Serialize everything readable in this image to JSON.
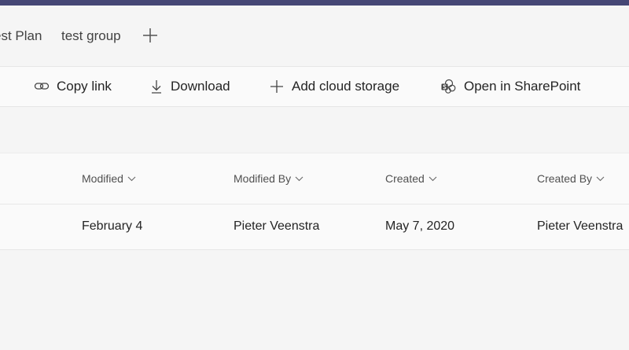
{
  "tabs": {
    "items": [
      {
        "label": "est Plan"
      },
      {
        "label": "test group"
      }
    ],
    "add_icon": "plus-icon"
  },
  "toolbar": {
    "copy_link": {
      "label": "Copy link",
      "icon": "link-icon"
    },
    "download": {
      "label": "Download",
      "icon": "download-icon"
    },
    "add_cloud_storage": {
      "label": "Add cloud storage",
      "icon": "plus-icon"
    },
    "open_in_sharepoint": {
      "label": "Open in SharePoint",
      "icon": "sharepoint-icon"
    }
  },
  "table": {
    "columns": [
      {
        "label": "Modified"
      },
      {
        "label": "Modified By"
      },
      {
        "label": "Created"
      },
      {
        "label": "Created By"
      }
    ],
    "rows": [
      {
        "modified": "February 4",
        "modified_by": "Pieter Veenstra",
        "created": "May 7, 2020",
        "created_by": "Pieter Veenstra"
      }
    ]
  },
  "colors": {
    "title_bar": "#464775",
    "background": "#f5f5f5",
    "surface": "#fafafa",
    "text": "#242424"
  }
}
